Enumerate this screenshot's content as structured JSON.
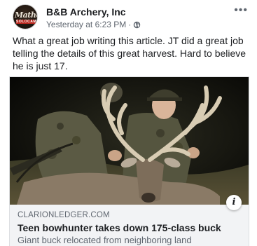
{
  "post": {
    "page_name": "B&B Archery, Inc",
    "timestamp": "Yesterday at 6:23 PM",
    "separator": "·",
    "privacy_icon": "globe-icon",
    "more_icon": "more-options-icon",
    "avatar_logo_text": "Mathews",
    "avatar_logo_sub": "SOLOCAM",
    "text": "What a great job writing this article. JT did a great job telling the details of this great harvest. Hard to believe he is just 17."
  },
  "link_card": {
    "domain": "CLARIONLEDGER.COM",
    "title": "Teen bowhunter takes down 175-class buck",
    "description": "Giant buck relocated from neighboring land",
    "info_icon": "i",
    "image_description_icon": "photo-of-hunters-with-buck"
  },
  "colors": {
    "primary_text": "#1c1e21",
    "secondary_text": "#606770",
    "card_background": "#f2f3f5",
    "border": "#dddfe2"
  }
}
